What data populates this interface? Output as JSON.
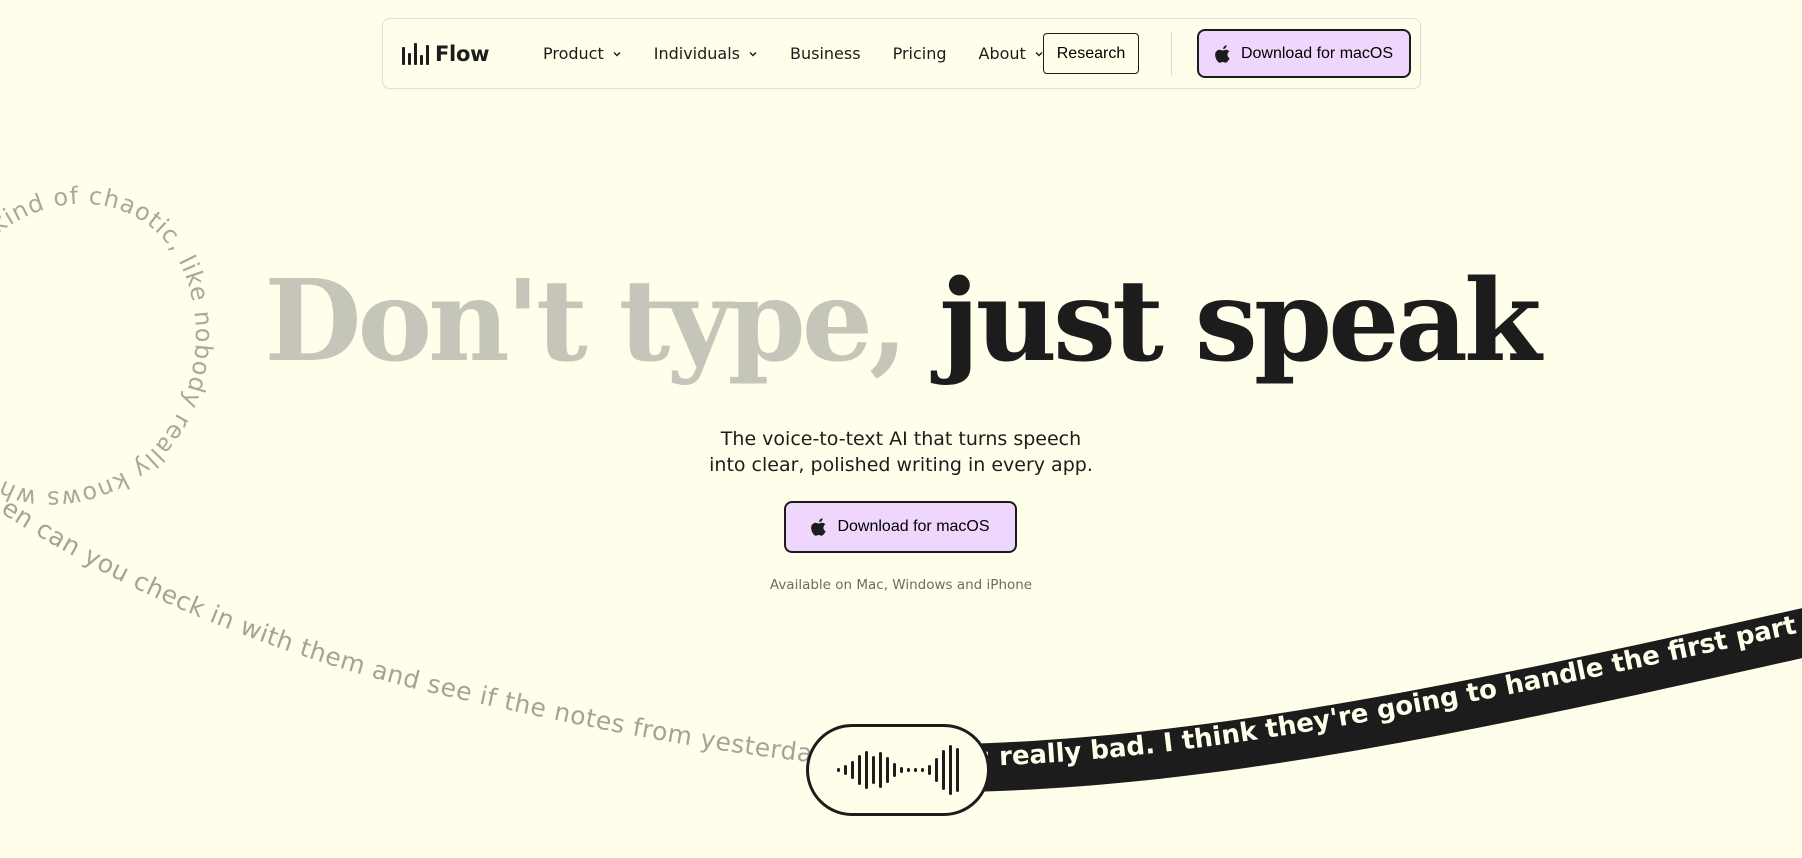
{
  "nav": {
    "brand": "Flow",
    "items": [
      {
        "label": "Product",
        "has_dropdown": true
      },
      {
        "label": "Individuals",
        "has_dropdown": true
      },
      {
        "label": "Business",
        "has_dropdown": false
      },
      {
        "label": "Pricing",
        "has_dropdown": false
      },
      {
        "label": "About",
        "has_dropdown": true
      }
    ],
    "research_label": "Research",
    "download_label": "Download for macOS",
    "download_icon": "apple-icon"
  },
  "hero": {
    "headline_muted": "Don't type,",
    "headline_dark": "just speak",
    "subhead_line1": "The voice-to-text AI that turns speech",
    "subhead_line2": "into clear, polished writing in every app.",
    "download_label": "Download for macOS",
    "availability": "Available on Mac, Windows and iPhone"
  },
  "decor": {
    "curve_text": "en can you check in with them and see if the notes from yesterday's meeting",
    "loop_text": "so kind of chaotic, like nobody really knows wh",
    "band_text": "s really bad. I think they're going to handle the first part of the pro"
  },
  "colors": {
    "background": "#FEFEEB",
    "accent": "#EFD6FD",
    "ink": "#1c1c1c",
    "muted_headline": "#c5c5b9",
    "curve_text": "#a3a39b"
  }
}
